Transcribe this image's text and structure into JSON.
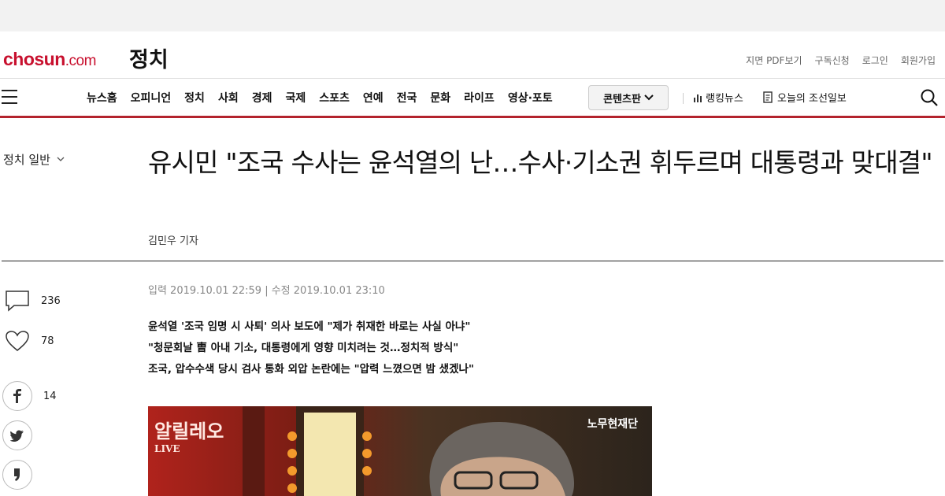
{
  "site": {
    "logo_main": "chosun",
    "logo_suffix": ".com",
    "section_title": "정치"
  },
  "util_links": [
    "지면 PDF보기",
    "구독신청",
    "로그인",
    "회원가입"
  ],
  "nav": {
    "items": [
      "뉴스홈",
      "오피니언",
      "정치",
      "사회",
      "경제",
      "국제",
      "스포츠",
      "연예",
      "전국",
      "문화",
      "라이프",
      "영상·포토"
    ],
    "content_button": "콘텐츠판",
    "ranking": "랭킹뉴스",
    "today_paper": "오늘의 조선일보"
  },
  "article": {
    "category": "정치 일반",
    "headline": "유시민 \"조국 수사는 윤석열의 난…수사·기소권 휘두르며 대통령과 맞대결\"",
    "byline": "김민우 기자",
    "dates": "입력 2019.10.01 22:59 | 수정 2019.10.01 23:10",
    "subheads": [
      "윤석열 '조국 임명 시 사퇴' 의사 보도에 \"제가 취재한 바로는 사실 아냐\"",
      "\"청문회날 曺 아내 기소, 대통령에게 영향 미치려는 것…정치적 방식\"",
      "조국, 압수수색 당시 검사 통화 외압 논란에는 \"압력 느꼈으면 밤 샜겠나\""
    ],
    "photo_logo_text": "알릴레오",
    "photo_live_text": "LIVE",
    "photo_watermark": "노무현재단"
  },
  "side": {
    "comment_count": "236",
    "like_count": "78",
    "share_count": "14"
  },
  "colors": {
    "brand": "#c8102e",
    "nav_rule": "#b3232d"
  }
}
